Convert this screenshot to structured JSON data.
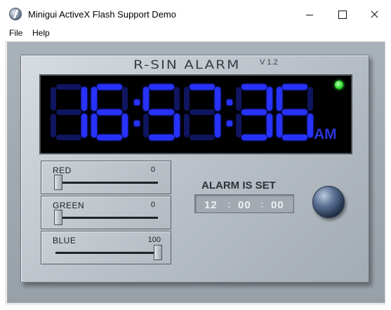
{
  "window": {
    "title": "Minigui ActiveX Flash Support Demo",
    "app_icon": "flash-icon"
  },
  "menu": {
    "items": [
      "File",
      "Help"
    ]
  },
  "alarm_clock": {
    "brand": "R-SIN ALARM",
    "version": "V 1.2",
    "time_display": "16:57:36",
    "ampm": "AM",
    "indicator_color": "#2ee12e",
    "digit_color": "#2732ff"
  },
  "sliders": [
    {
      "label": "RED",
      "value": "0",
      "level": 0
    },
    {
      "label": "GREEN",
      "value": "0",
      "level": 0
    },
    {
      "label": "BLUE",
      "value": "100",
      "level": 1
    }
  ],
  "alarm": {
    "title": "ALARM IS SET",
    "hour": "12",
    "minute": "00",
    "second": "00",
    "separator": ":"
  }
}
